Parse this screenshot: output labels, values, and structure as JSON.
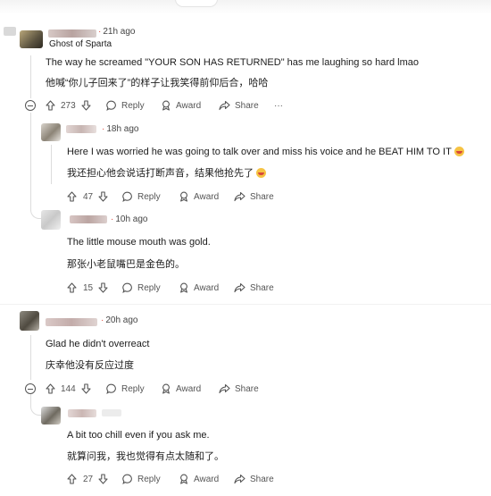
{
  "comments": [
    {
      "time": "21h ago",
      "flair": "Ghost of Sparta",
      "body_en": "The way he screamed \"YOUR SON HAS RETURNED\" has me laughing so hard lmao",
      "body_zh": "他喊“你儿子回来了”的样子让我笑得前仰后合，哈哈",
      "votes": "273",
      "reply": "Reply",
      "award": "Award",
      "share": "Share",
      "more": "···"
    },
    {
      "time": "18h ago",
      "body_en": "Here I was worried he was going to talk over and miss his voice and he BEAT HIM TO IT",
      "body_zh": "我还担心他会说话打断声音，结果他抢先了",
      "votes": "47",
      "reply": "Reply",
      "award": "Award",
      "share": "Share"
    },
    {
      "time": "10h ago",
      "body_en": "The little mouse mouth was gold.",
      "body_zh": "那张小老鼠嘴巴是金色的。",
      "votes": "15",
      "reply": "Reply",
      "award": "Award",
      "share": "Share"
    },
    {
      "time": "20h ago",
      "body_en": "Glad he didn't overreact",
      "body_zh": "庆幸他没有反应过度",
      "votes": "144",
      "reply": "Reply",
      "award": "Award",
      "share": "Share"
    },
    {
      "time": "",
      "body_en": "A bit too chill even if you ask me.",
      "body_zh": "就算问我，我也觉得有点太随和了。",
      "votes": "27",
      "reply": "Reply",
      "award": "Award",
      "share": "Share"
    }
  ],
  "icons": {
    "upvote": "arrow-up-icon",
    "downvote": "arrow-down-icon",
    "reply": "speech-bubble-icon",
    "award": "award-ribbon-icon",
    "share": "share-arrow-icon",
    "collapse": "collapse-minus-icon"
  },
  "colors": {
    "timestamp_dot": "#e0483a",
    "text": "#1c1c1c",
    "muted": "#555555"
  }
}
